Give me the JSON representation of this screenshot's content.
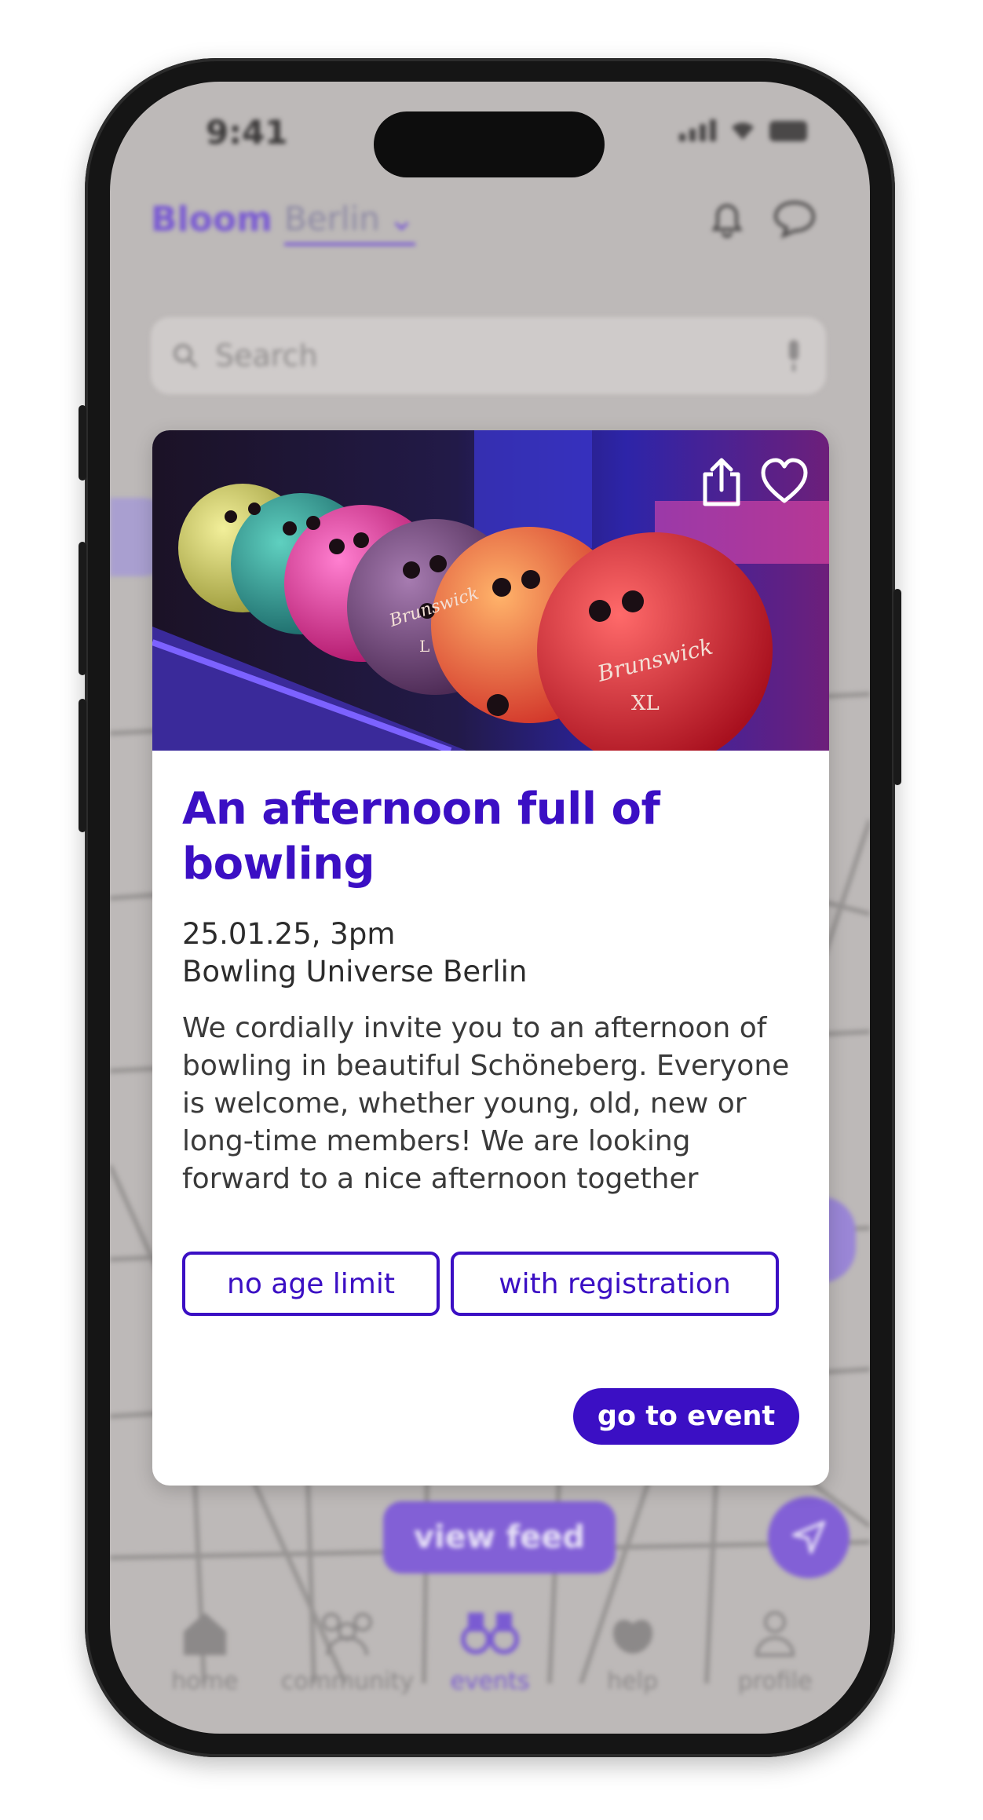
{
  "status_bar": {
    "time": "9:41"
  },
  "app_header": {
    "brand": "Bloom",
    "city": "Berlin"
  },
  "search": {
    "placeholder": "Search"
  },
  "map": {
    "view_feed_label": "view feed"
  },
  "bottom_nav": {
    "items": [
      {
        "label": "home",
        "icon": "home-icon"
      },
      {
        "label": "community",
        "icon": "community-icon"
      },
      {
        "label": "events",
        "icon": "binoculars-icon",
        "active": true
      },
      {
        "label": "help",
        "icon": "helping-hands-icon"
      },
      {
        "label": "profile",
        "icon": "profile-icon"
      }
    ]
  },
  "event_card": {
    "title": "An afternoon full of bowling",
    "date_time": "25.01.25, 3pm",
    "location": "Bowling Universe Berlin",
    "description": "We cordially invite you to an afternoon of bowling in beautiful Schöneberg. Everyone is welcome, whether young, old, new or long-time members! We are looking forward to a nice afternoon together",
    "tags": [
      "no age limit",
      "with registration"
    ],
    "cta_label": "go to event",
    "image_text": {
      "ball_brand": "Brunswick",
      "size_l": "L",
      "size_xl": "XL"
    }
  },
  "colors": {
    "accent": "#3b0fc4",
    "accent_light": "#8260d6",
    "overlay": "#bdb9b8"
  }
}
